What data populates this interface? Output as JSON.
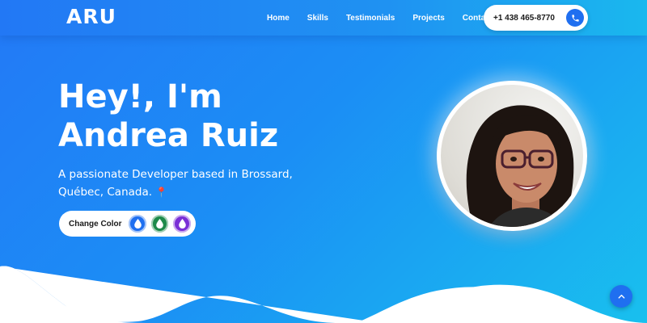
{
  "brand": {
    "logo": "ARU"
  },
  "nav": {
    "links": [
      "Home",
      "Skills",
      "Testimonials",
      "Projects",
      "Contact"
    ],
    "phone": "+1 438 465-8770"
  },
  "hero": {
    "title_line1": "Hey!, I'm",
    "title_line2": "Andrea Ruiz",
    "subtitle_line1": "A passionate Developer based in Brossard,",
    "subtitle_line2": "Québec, Canada.",
    "pin_glyph": "📍"
  },
  "color_picker": {
    "label": "Change Color",
    "swatches": [
      "#1f6ff0",
      "#1e8a4a",
      "#7a2fd6"
    ]
  },
  "icons": [
    "phone-icon",
    "droplet-icon",
    "arrow-up-icon",
    "location-pin-icon"
  ],
  "colors": {
    "accent": "#1f6ff0",
    "gradient_start": "#2379f6",
    "gradient_end": "#19c0ee"
  }
}
